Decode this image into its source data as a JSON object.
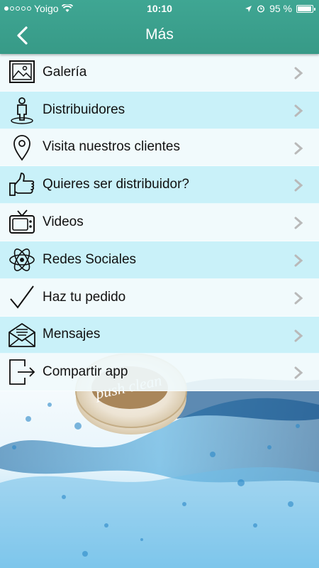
{
  "status_bar": {
    "carrier": "Yoigo",
    "time": "10:10",
    "battery_percent": "95 %",
    "battery_level": 0.95,
    "signal_dots_filled": 1,
    "signal_dots_total": 5
  },
  "header": {
    "title": "Más",
    "back_icon": "chevron-left-icon",
    "background_color": "#3aa08c"
  },
  "menu": {
    "items": [
      {
        "label": "Galería",
        "icon": "image-icon"
      },
      {
        "label": "Distribuidores",
        "icon": "person-icon"
      },
      {
        "label": "Visita nuestros clientes",
        "icon": "map-pin-icon"
      },
      {
        "label": "Quieres ser distribuidor?",
        "icon": "thumbs-up-icon"
      },
      {
        "label": "Videos",
        "icon": "tv-icon"
      },
      {
        "label": "Redes Sociales",
        "icon": "atom-icon"
      },
      {
        "label": "Haz tu pedido",
        "icon": "checkmark-icon"
      },
      {
        "label": "Mensajes",
        "icon": "envelope-icon"
      },
      {
        "label": "Compartir app",
        "icon": "share-exit-icon"
      }
    ],
    "row_colors": [
      "#f0fafc",
      "#c4f0f8"
    ]
  },
  "background": {
    "logo_text": "push clean"
  }
}
